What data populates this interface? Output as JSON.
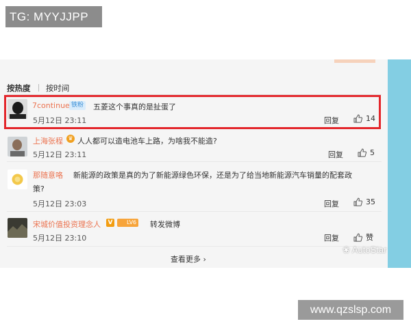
{
  "top_tag": "TG: MYYJJPP",
  "sort": {
    "hot": "按热度",
    "time": "按时间"
  },
  "comments": [
    {
      "user": "7continue",
      "badge": "铁粉",
      "text": "五菱这个事真的是扯蛋了",
      "time": "5月12日 23:11",
      "reply": "回复",
      "likes": "14"
    },
    {
      "user": "上海张程",
      "text": "人人都可以造电池车上路，为啥我不能造?",
      "time": "5月12日 23:11",
      "reply": "回复",
      "likes": "5"
    },
    {
      "user": "那随意咯",
      "text_line1": "新能源的政策是真的为了新能源绿色环保，还是为了给当地新能源汽车销量的配套政",
      "text_line2": "策?",
      "time": "5月12日 23:03",
      "reply": "回复",
      "likes": "35"
    },
    {
      "user": "宋城价值投资理念人",
      "badge_v": "V",
      "badge_lv": "LV6",
      "text": "转发微博",
      "time": "5月12日 23:10",
      "reply": "回复",
      "likes": "赞"
    }
  ],
  "more": "查看更多",
  "watermark": "AutoStar",
  "site": "www.qzslsp.com",
  "colors": {
    "username": "#eb7350",
    "highlight": "#e3262b",
    "sidebar": "#83cee3"
  }
}
